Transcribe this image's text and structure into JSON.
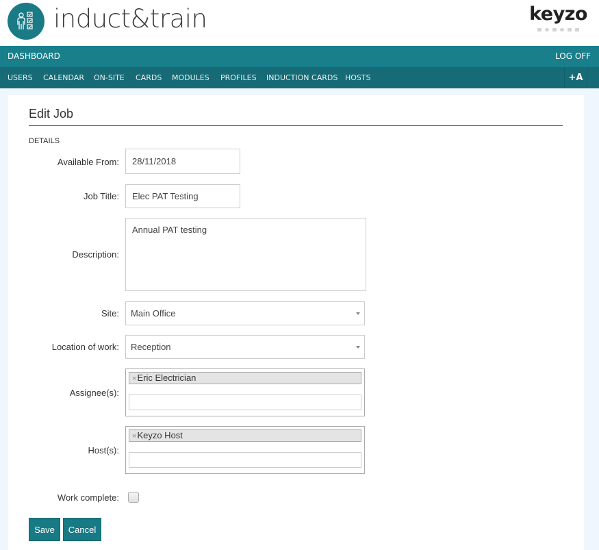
{
  "app": {
    "brand_name": "induct&train",
    "vendor_name": "keyzo",
    "accent_color": "#187f8b"
  },
  "nav_primary": {
    "dashboard": "DASHBOARD",
    "log_off": "LOG OFF"
  },
  "nav_secondary": {
    "items": [
      {
        "label": "USERS"
      },
      {
        "label": "CALENDAR"
      },
      {
        "label": "ON-SITE"
      },
      {
        "label": "CARDS"
      },
      {
        "label": "MODULES"
      },
      {
        "label": "PROFILES"
      },
      {
        "label": "INDUCTION CARDS"
      },
      {
        "label": "HOSTS"
      }
    ],
    "text_size_button": "+A"
  },
  "form": {
    "title": "Edit Job",
    "section": "DETAILS",
    "available_from": {
      "label": "Available From:",
      "value": "28/11/2018"
    },
    "job_title": {
      "label": "Job Title:",
      "value": "Elec PAT Testing"
    },
    "description": {
      "label": "Description:",
      "value": "Annual PAT testing"
    },
    "site": {
      "label": "Site:",
      "value": "Main Office"
    },
    "location": {
      "label": "Location of work:",
      "value": "Reception"
    },
    "assignees": {
      "label": "Assignee(s):",
      "selected": [
        "Eric Electrician"
      ],
      "remove_glyph": "×"
    },
    "hosts": {
      "label": "Host(s):",
      "selected": [
        "Keyzo Host"
      ],
      "remove_glyph": "×"
    },
    "work_complete": {
      "label": "Work complete:",
      "checked": false
    },
    "save_label": "Save",
    "cancel_label": "Cancel"
  }
}
